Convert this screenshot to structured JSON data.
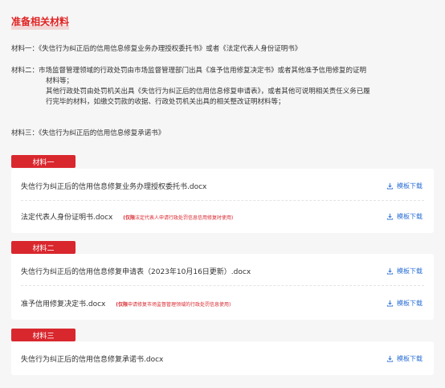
{
  "title": "准备相关材料",
  "descriptions": {
    "m1": "材料一：《失信行为纠正后的信用信息修复业务办理授权委托书》或者《法定代表人身份证明书》",
    "m2_line1": "材料二：市场监督管理领域的行政处罚由市场监督管理部门出具《准予信用修复决定书》或者其他准予信用修复的证明",
    "m2_line2": "材料等；",
    "m2_line3": "其他行政处罚由处罚机关出具《失信行为纠正后的信用信息修复申请表》，或者其他可说明相关责任义务已履",
    "m2_line4": "行完毕的材料，如缴交罚款的收据、行政处罚机关出具的相关整改证明材料等；",
    "m3": "材料三：《失信行为纠正后的信用信息修复承诺书》"
  },
  "groups": [
    {
      "label": "材料一",
      "files": [
        {
          "name": "失信行为纠正后的信用信息修复业务办理授权委托书.docx",
          "note_strong": "",
          "note": "",
          "download": "模板下载"
        },
        {
          "name": "法定代表人身份证明书.docx",
          "note_strong": "(仅限",
          "note": "法定代表人申请行政处罚信息信用修复时使用)",
          "download": "模板下载"
        }
      ]
    },
    {
      "label": "材料二",
      "files": [
        {
          "name": "失信行为纠正后的信用信息修复申请表（2023年10月16日更新）.docx",
          "note_strong": "",
          "note": "",
          "download": "模板下载"
        },
        {
          "name": "准予信用修复决定书.docx",
          "note_strong": "(仅限",
          "note": "申请修复市场监督管理领域的行政处罚信息使用)",
          "download": "模板下载"
        }
      ]
    },
    {
      "label": "材料三",
      "files": [
        {
          "name": "失信行为纠正后的信用信息修复承诺书.docx",
          "note_strong": "",
          "note": "",
          "download": "模板下载"
        }
      ]
    }
  ],
  "colors": {
    "accent": "#d9272e",
    "link": "#2b6fd6"
  },
  "icons": {
    "download": "download-icon"
  }
}
